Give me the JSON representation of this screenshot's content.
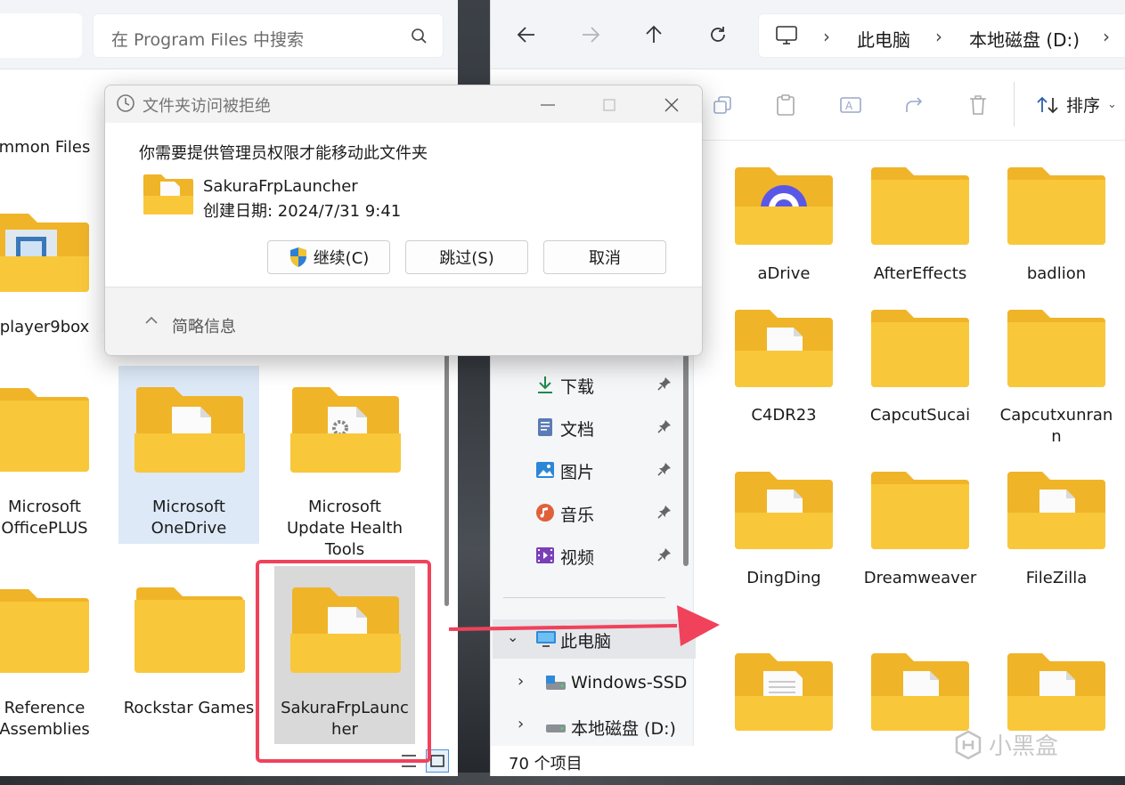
{
  "left_window": {
    "search_placeholder": "在 Program Files 中搜索",
    "tiles": [
      {
        "label": "mmon Files"
      },
      {
        "label": "player9box"
      },
      {
        "label": "Microsoft\nOfficePLUS"
      },
      {
        "label": "Microsoft\nOneDrive"
      },
      {
        "label": "Microsoft\nUpdate Health\nTools"
      },
      {
        "label": "Reference\nAssemblies"
      },
      {
        "label": "Rockstar Games"
      },
      {
        "label": "SakuraFrpLaunc\nher"
      }
    ]
  },
  "right_window": {
    "breadcrumb": [
      "此电脑",
      "本地磁盘 (D:)"
    ],
    "sort_label": "排序",
    "nav_items": [
      {
        "label": "下载",
        "icon": "download-icon"
      },
      {
        "label": "文档",
        "icon": "document-icon"
      },
      {
        "label": "图片",
        "icon": "pictures-icon"
      },
      {
        "label": "音乐",
        "icon": "music-icon"
      },
      {
        "label": "视频",
        "icon": "video-icon"
      }
    ],
    "tree": [
      {
        "label": "此电脑"
      },
      {
        "label": "Windows-SSD"
      },
      {
        "label": "本地磁盘 (D:)"
      }
    ],
    "folders": [
      {
        "label": "aDrive"
      },
      {
        "label": "AfterEffects"
      },
      {
        "label": "badlion"
      },
      {
        "label": "C4DR23"
      },
      {
        "label": "CapcutSucai"
      },
      {
        "label": "Capcutxunran\nn"
      },
      {
        "label": "DingDing"
      },
      {
        "label": "Dreamweaver"
      },
      {
        "label": "FileZilla"
      }
    ],
    "status": "70 个项目"
  },
  "dialog": {
    "title": "文件夹访问被拒绝",
    "message": "你需要提供管理员权限才能移动此文件夹",
    "folder_name": "SakuraFrpLauncher",
    "created": "创建日期: 2024/7/31 9:41",
    "continue_label": "继续(C)",
    "skip_label": "跳过(S)",
    "cancel_label": "取消",
    "details_label": "简略信息"
  },
  "watermark": "小黑盒",
  "colors": {
    "folder": "#f9c73a",
    "folder_back": "#f0b429",
    "highlight": "#f0425b",
    "selection": "#dde9f7"
  }
}
